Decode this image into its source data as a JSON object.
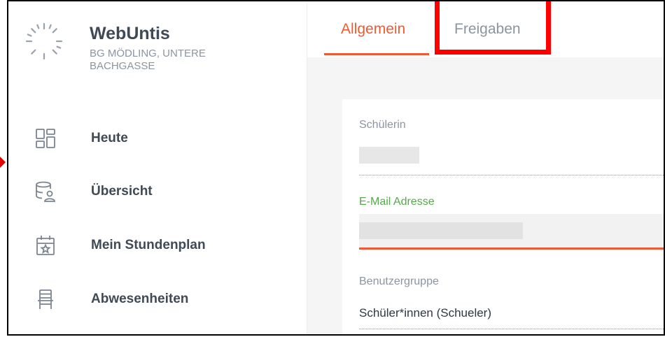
{
  "app": {
    "title": "WebUntis",
    "school": "BG MÖDLING, UNTERE BACHGASSE"
  },
  "sidebar": {
    "items": [
      {
        "label": "Heute",
        "icon": "dashboard-icon"
      },
      {
        "label": "Übersicht",
        "icon": "user-database-icon"
      },
      {
        "label": "Mein Stundenplan",
        "icon": "calendar-star-icon"
      },
      {
        "label": "Abwesenheiten",
        "icon": "chair-icon"
      }
    ]
  },
  "tabs": [
    {
      "label": "Allgemein",
      "active": true
    },
    {
      "label": "Freigaben",
      "active": false
    }
  ],
  "form": {
    "student_label": "Schülerin",
    "email_label": "E-Mail Adresse",
    "group_label": "Benutzergruppe",
    "group_value": "Schüler*innen (Schueler)"
  },
  "colors": {
    "accent": "#f05a32",
    "label_green": "#57a84c",
    "text": "#3f4a56",
    "muted": "#8b95a1",
    "highlight": "#ff0000"
  }
}
